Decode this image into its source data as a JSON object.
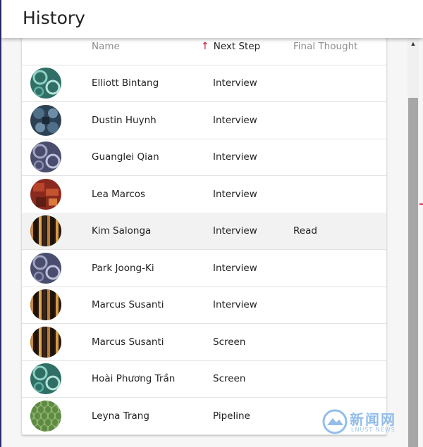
{
  "header": {
    "title": "History"
  },
  "table": {
    "columns": {
      "name": "Name",
      "next_step": "Next Step",
      "final_thought": "Final Thought"
    },
    "sort": {
      "column": "Next Step",
      "direction": "ascending",
      "indicator_icon": "arrow-up-icon",
      "color": "#c8102e"
    },
    "rows": [
      {
        "name": "Elliott Bintang",
        "next_step": "Interview",
        "final_thought": "",
        "avatar": "teal-swirl"
      },
      {
        "name": "Dustin Huynh",
        "next_step": "Interview",
        "final_thought": "",
        "avatar": "slate-blocks"
      },
      {
        "name": "Guanglei Qian",
        "next_step": "Interview",
        "final_thought": "",
        "avatar": "violet-swirl"
      },
      {
        "name": "Lea Marcos",
        "next_step": "Interview",
        "final_thought": "",
        "avatar": "red-blocks"
      },
      {
        "name": "Kim Salonga",
        "next_step": "Interview",
        "final_thought": "Read",
        "avatar": "amber-stripes",
        "selected": true
      },
      {
        "name": "Park Joong-Ki",
        "next_step": "Interview",
        "final_thought": "",
        "avatar": "violet-swirl"
      },
      {
        "name": "Marcus Susanti",
        "next_step": "Interview",
        "final_thought": "",
        "avatar": "amber-stripes"
      },
      {
        "name": "Marcus Susanti",
        "next_step": "Screen",
        "final_thought": "",
        "avatar": "amber-stripes"
      },
      {
        "name": "Hoài Phương Trần",
        "next_step": "Screen",
        "final_thought": "",
        "avatar": "teal-swirl"
      },
      {
        "name": "Leyna Trang",
        "next_step": "Pipeline",
        "final_thought": "",
        "avatar": "green-scales"
      }
    ]
  },
  "watermark": {
    "text": "新闻网",
    "subtext": "LNUST NEWS"
  },
  "colors": {
    "accent": "#c8102e",
    "selected_row": "#f2f2f2"
  }
}
